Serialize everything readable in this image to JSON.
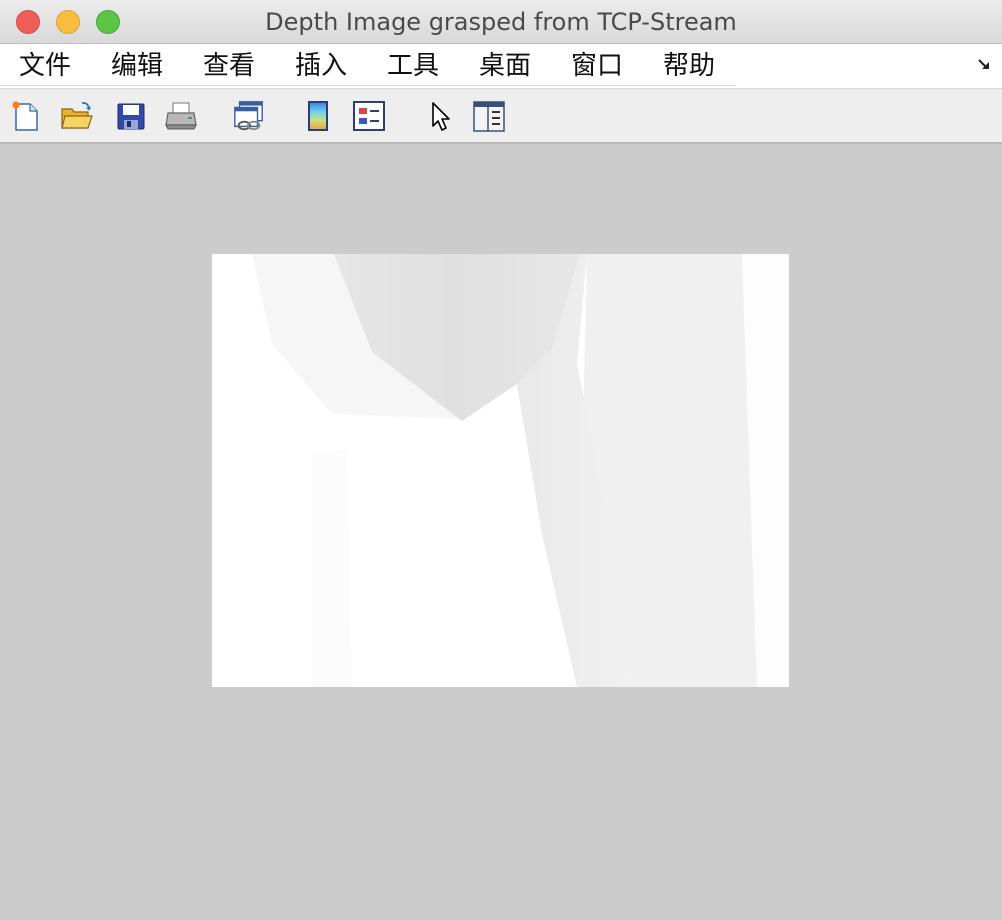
{
  "window": {
    "title": "Depth Image grasped from TCP-Stream"
  },
  "menu": {
    "items": [
      {
        "id": "file",
        "label": "文件"
      },
      {
        "id": "edit",
        "label": "编辑"
      },
      {
        "id": "view",
        "label": "查看"
      },
      {
        "id": "insert",
        "label": "插入"
      },
      {
        "id": "tools",
        "label": "工具"
      },
      {
        "id": "desktop",
        "label": "桌面"
      },
      {
        "id": "window",
        "label": "窗口"
      },
      {
        "id": "help",
        "label": "帮助"
      }
    ]
  },
  "toolbar": {
    "buttons": [
      {
        "name": "new-figure-icon"
      },
      {
        "name": "open-folder-icon"
      },
      {
        "name": "save-disk-icon"
      },
      {
        "name": "print-icon"
      },
      {
        "name": "link-plot-icon"
      },
      {
        "name": "colorbar-icon"
      },
      {
        "name": "legend-icon"
      },
      {
        "name": "edit-plot-pointer-icon"
      },
      {
        "name": "property-inspector-icon"
      }
    ]
  },
  "colors": {
    "close": "#ee5f58",
    "minimize": "#f8bd3d",
    "maximize": "#5cc544",
    "figure_background": "#cccccc",
    "image_background": "#ffffff"
  }
}
